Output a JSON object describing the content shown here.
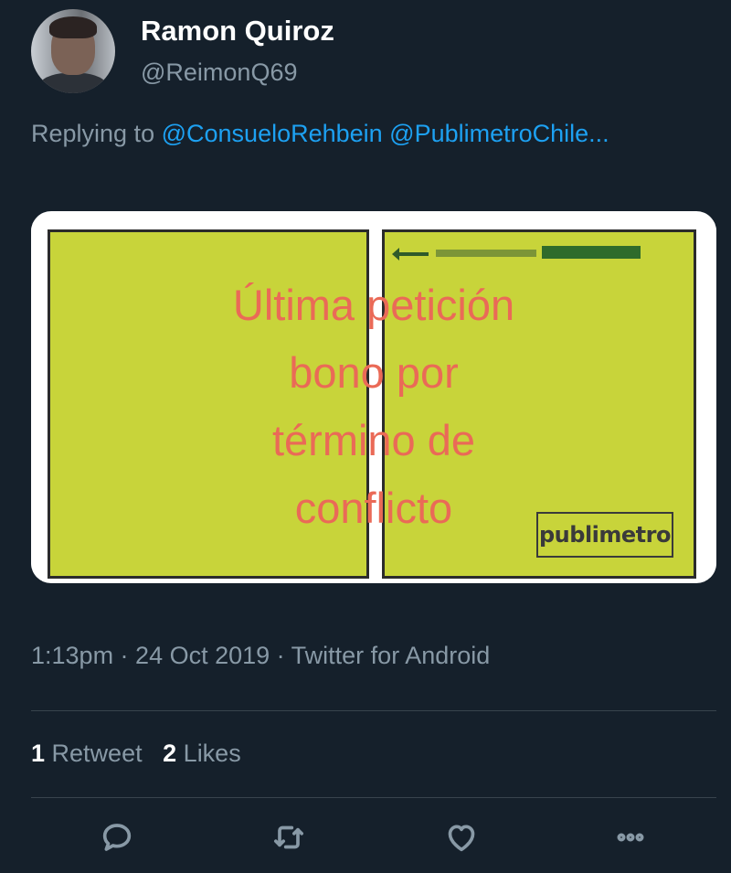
{
  "tweet": {
    "author_name": "Ramon Quiroz",
    "author_handle": "@ReimonQ69",
    "replying_prefix": "Replying to",
    "replying_to": "@ConsueloRehbein @PublimetroChile...",
    "overlay_lines": [
      "Última petición",
      "bono por",
      "término de",
      "conflicto"
    ],
    "newspaper_logo": "publimetro",
    "timestamp": "1:13pm · 24 Oct 2019 · Twitter for Android",
    "retweet_count": "1",
    "retweet_label": "Retweet",
    "likes_count": "2",
    "likes_label": "Likes"
  },
  "icons": {
    "reply": "reply-icon",
    "retweet": "retweet-icon",
    "like": "heart-icon",
    "more": "more-icon"
  },
  "colors": {
    "background": "#15202b",
    "secondary_text": "#8899a6",
    "mention": "#1da1f2",
    "overlay_text": "#ea6a57",
    "newspaper_panel": "#c8d43a"
  }
}
